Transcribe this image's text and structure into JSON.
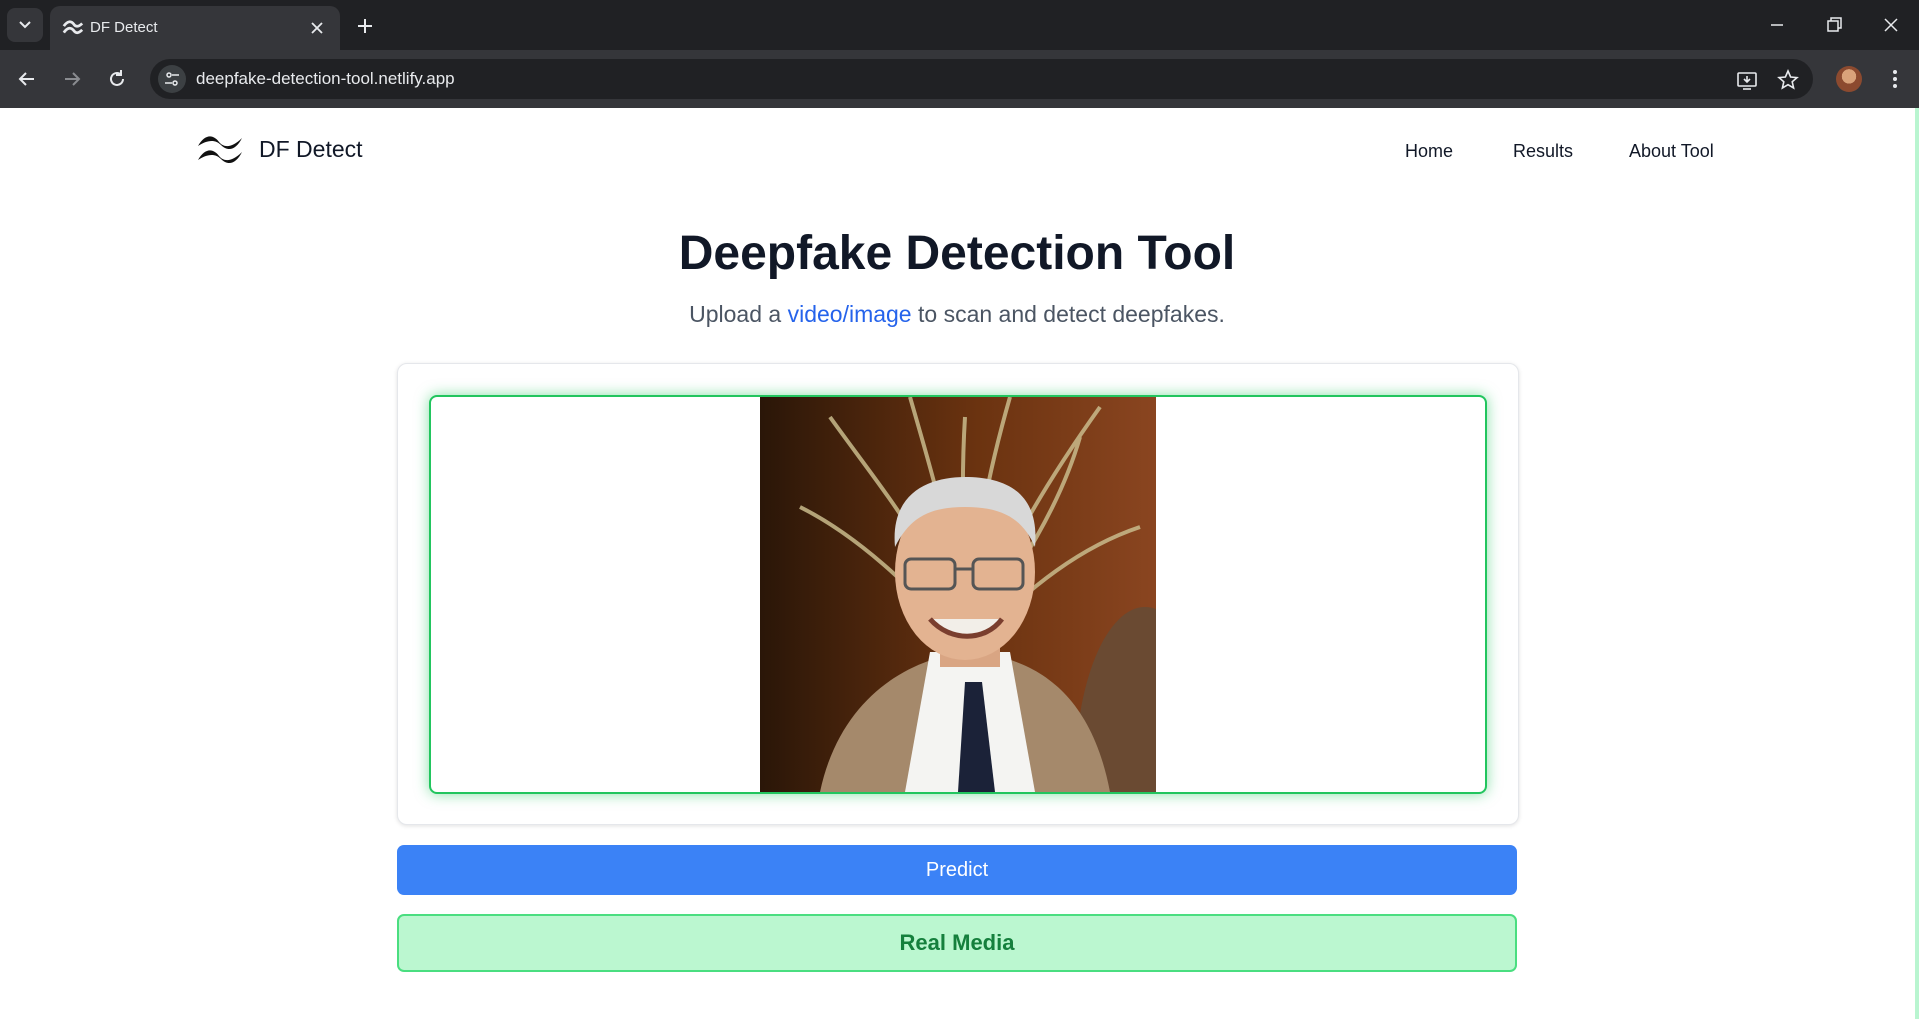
{
  "browser": {
    "tab_title": "DF Detect",
    "url": "deepfake-detection-tool.netlify.app"
  },
  "site": {
    "brand": "DF Detect",
    "nav": [
      {
        "label": "Home"
      },
      {
        "label": "Results"
      },
      {
        "label": "About Tool"
      }
    ]
  },
  "main": {
    "title": "Deepfake Detection Tool",
    "subtitle_before": "Upload a ",
    "subtitle_highlight": "video/image",
    "subtitle_after": " to scan and detect deepfakes.",
    "predict_label": "Predict",
    "result_label": "Real Media",
    "accent_color": "#22c55e",
    "button_color": "#3b82f6"
  }
}
